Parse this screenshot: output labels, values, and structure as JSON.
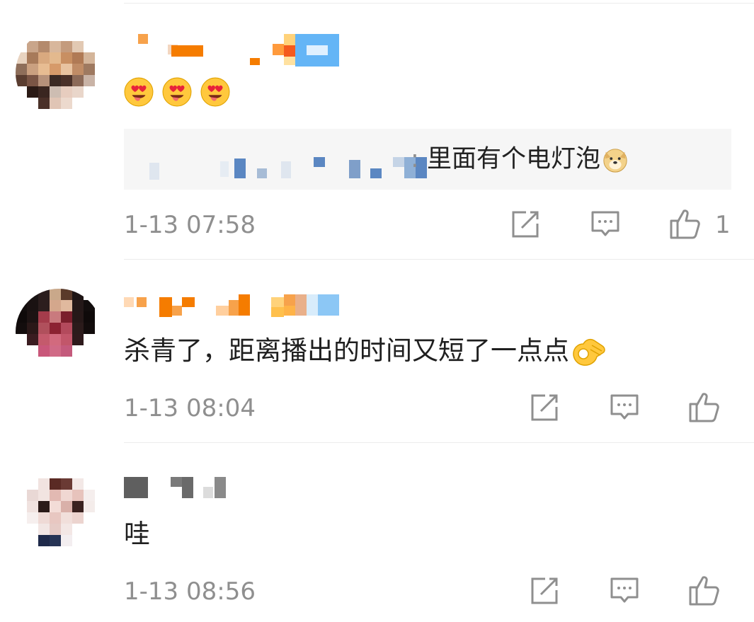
{
  "comments": [
    {
      "emojis": [
        "heart-eyes-tongue",
        "heart-eyes-tongue",
        "heart-eyes-tongue"
      ],
      "quote": {
        "prefix": ":",
        "text": "里面有个电灯泡",
        "emoji": "doge"
      },
      "time": "1-13 07:58",
      "likes": "1"
    },
    {
      "text": "杀青了，距离播出的时间又短了一点点",
      "emoji": "ok-hand",
      "time": "1-13 08:04"
    },
    {
      "text": "哇",
      "time": "1-13 08:56"
    }
  ],
  "icons": {
    "repost": "repost-icon",
    "comment": "comment-icon",
    "like": "like-icon"
  },
  "colors": {
    "meta": "#8f8f8f",
    "accent_orange": "#f57c00",
    "accent_blue": "#64b5f6"
  }
}
